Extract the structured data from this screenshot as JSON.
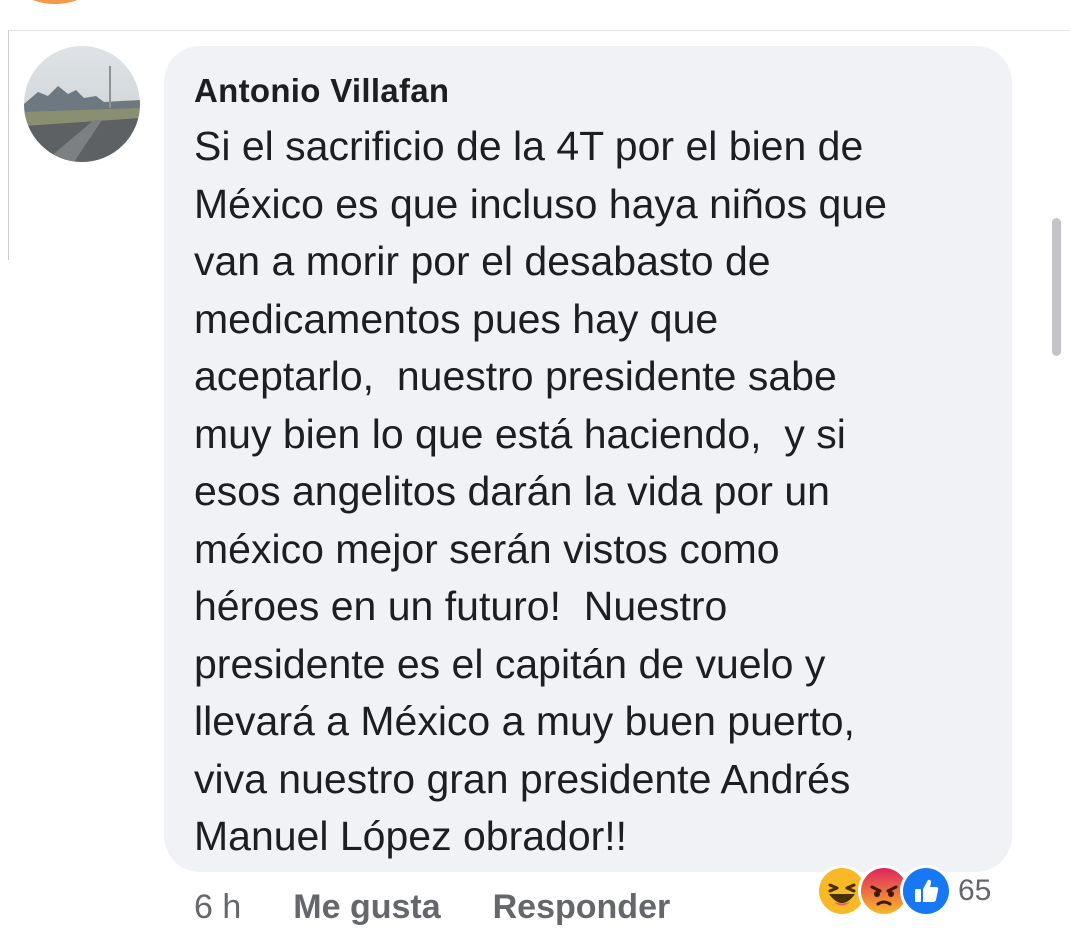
{
  "comment": {
    "author": "Antonio Villafan",
    "text_lines": [
      "Si el sacrificio de la 4T por el bien de",
      "México es que incluso haya niños que",
      "van a morir por el desabasto de",
      "medicamentos pues hay que",
      "aceptarlo,  nuestro presidente sabe",
      "muy bien lo que está haciendo,  y si",
      "esos angelitos darán la vida por un",
      "méxico mejor serán vistos como",
      "héroes en un futuro!  Nuestro",
      "presidente es el capitán de vuelo y",
      "llevará a México a muy buen puerto,",
      "viva nuestro gran presidente Andrés",
      "Manuel López obrador!!"
    ]
  },
  "actions": {
    "time": "6 h",
    "like_label": "Me gusta",
    "reply_label": "Responder"
  },
  "reactions": {
    "icons": [
      "haha-reaction-icon",
      "angry-reaction-icon",
      "like-reaction-icon"
    ],
    "count": "65"
  },
  "colors": {
    "bubble": "#f0f2f5",
    "text": "#1c1e21",
    "secondary_text": "#65676b",
    "like_blue": "#1877f2",
    "haha_yellow": "#f7b928",
    "angry_orange": "#e9710f"
  }
}
